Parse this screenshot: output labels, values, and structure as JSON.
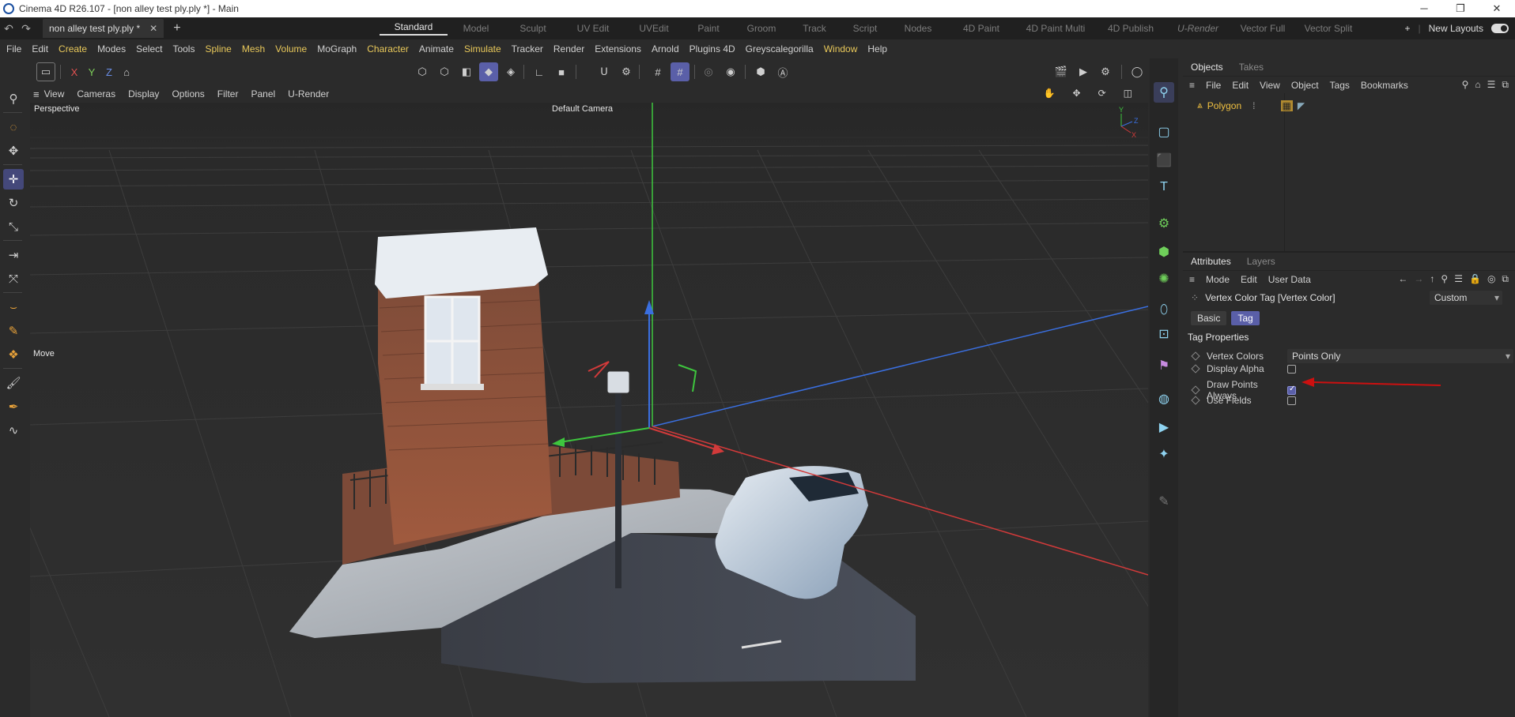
{
  "window": {
    "title": "Cinema 4D R26.107 - [non alley test ply.ply *] - Main",
    "minimize": "─",
    "maximize": "❐",
    "close": "✕"
  },
  "tabbar": {
    "doc_tab": "non alley test ply.ply *",
    "close_glyph": "✕",
    "add_glyph": "+",
    "layouts": [
      "Standard",
      "Model",
      "Sculpt",
      "UV Edit",
      "UVEdit",
      "Paint",
      "Groom",
      "Track",
      "Script",
      "Nodes",
      "4D Paint",
      "4D Paint Multi",
      "4D Publish",
      "U-Render",
      "Vector Full",
      "Vector Split"
    ],
    "active_layout": "Standard",
    "new_layouts_label": "New Layouts",
    "plus_glyph": "+"
  },
  "menubar": [
    {
      "label": "File",
      "hl": false
    },
    {
      "label": "Edit",
      "hl": false
    },
    {
      "label": "Create",
      "hl": true
    },
    {
      "label": "Modes",
      "hl": false
    },
    {
      "label": "Select",
      "hl": false
    },
    {
      "label": "Tools",
      "hl": false
    },
    {
      "label": "Spline",
      "hl": true
    },
    {
      "label": "Mesh",
      "hl": true
    },
    {
      "label": "Volume",
      "hl": true
    },
    {
      "label": "MoGraph",
      "hl": false
    },
    {
      "label": "Character",
      "hl": true
    },
    {
      "label": "Animate",
      "hl": false
    },
    {
      "label": "Simulate",
      "hl": true
    },
    {
      "label": "Tracker",
      "hl": false
    },
    {
      "label": "Render",
      "hl": false
    },
    {
      "label": "Extensions",
      "hl": false
    },
    {
      "label": "Arnold",
      "hl": false
    },
    {
      "label": "Plugins 4D",
      "hl": false
    },
    {
      "label": "Greyscalegorilla",
      "hl": false
    },
    {
      "label": "Window",
      "hl": true
    },
    {
      "label": "Help",
      "hl": false
    }
  ],
  "toolbar": {
    "axis_x": "X",
    "axis_y": "Y",
    "axis_z": "Z"
  },
  "viewport": {
    "menu": [
      "View",
      "Cameras",
      "Display",
      "Options",
      "Filter",
      "Panel",
      "U-Render"
    ],
    "view_name": "Perspective",
    "camera_name": "Default Camera",
    "tool_label": "Move",
    "axis_y": "Y",
    "axis_z": "Z",
    "axis_x": "X"
  },
  "objects_panel": {
    "tabs": [
      "Objects",
      "Takes"
    ],
    "active_tab": "Objects",
    "menu": [
      "File",
      "Edit",
      "View",
      "Object",
      "Tags",
      "Bookmarks"
    ],
    "object_name": "Polygon"
  },
  "attributes_panel": {
    "tabs": [
      "Attributes",
      "Layers"
    ],
    "active_tab": "Attributes",
    "menu": [
      "Mode",
      "Edit",
      "User Data"
    ],
    "title": "Vertex Color Tag [Vertex Color]",
    "preset": "Custom",
    "buttons": [
      "Basic",
      "Tag"
    ],
    "active_button": "Tag",
    "section_title": "Tag Properties",
    "vertex_colors_label": "Vertex Colors",
    "vertex_colors_value": "Points Only",
    "display_alpha_label": "Display Alpha",
    "display_alpha_checked": false,
    "draw_points_label": "Draw Points Always",
    "draw_points_checked": true,
    "use_fields_label": "Use Fields",
    "use_fields_checked": false
  },
  "colors": {
    "accent": "#5a5fa8",
    "highlight_menu": "#e8c85a",
    "object_name": "#f0c040",
    "arrow_annotation": "#cc1010",
    "axis_red": "#d23a3a",
    "axis_green": "#3ec63e",
    "axis_blue": "#3a6fe0"
  }
}
